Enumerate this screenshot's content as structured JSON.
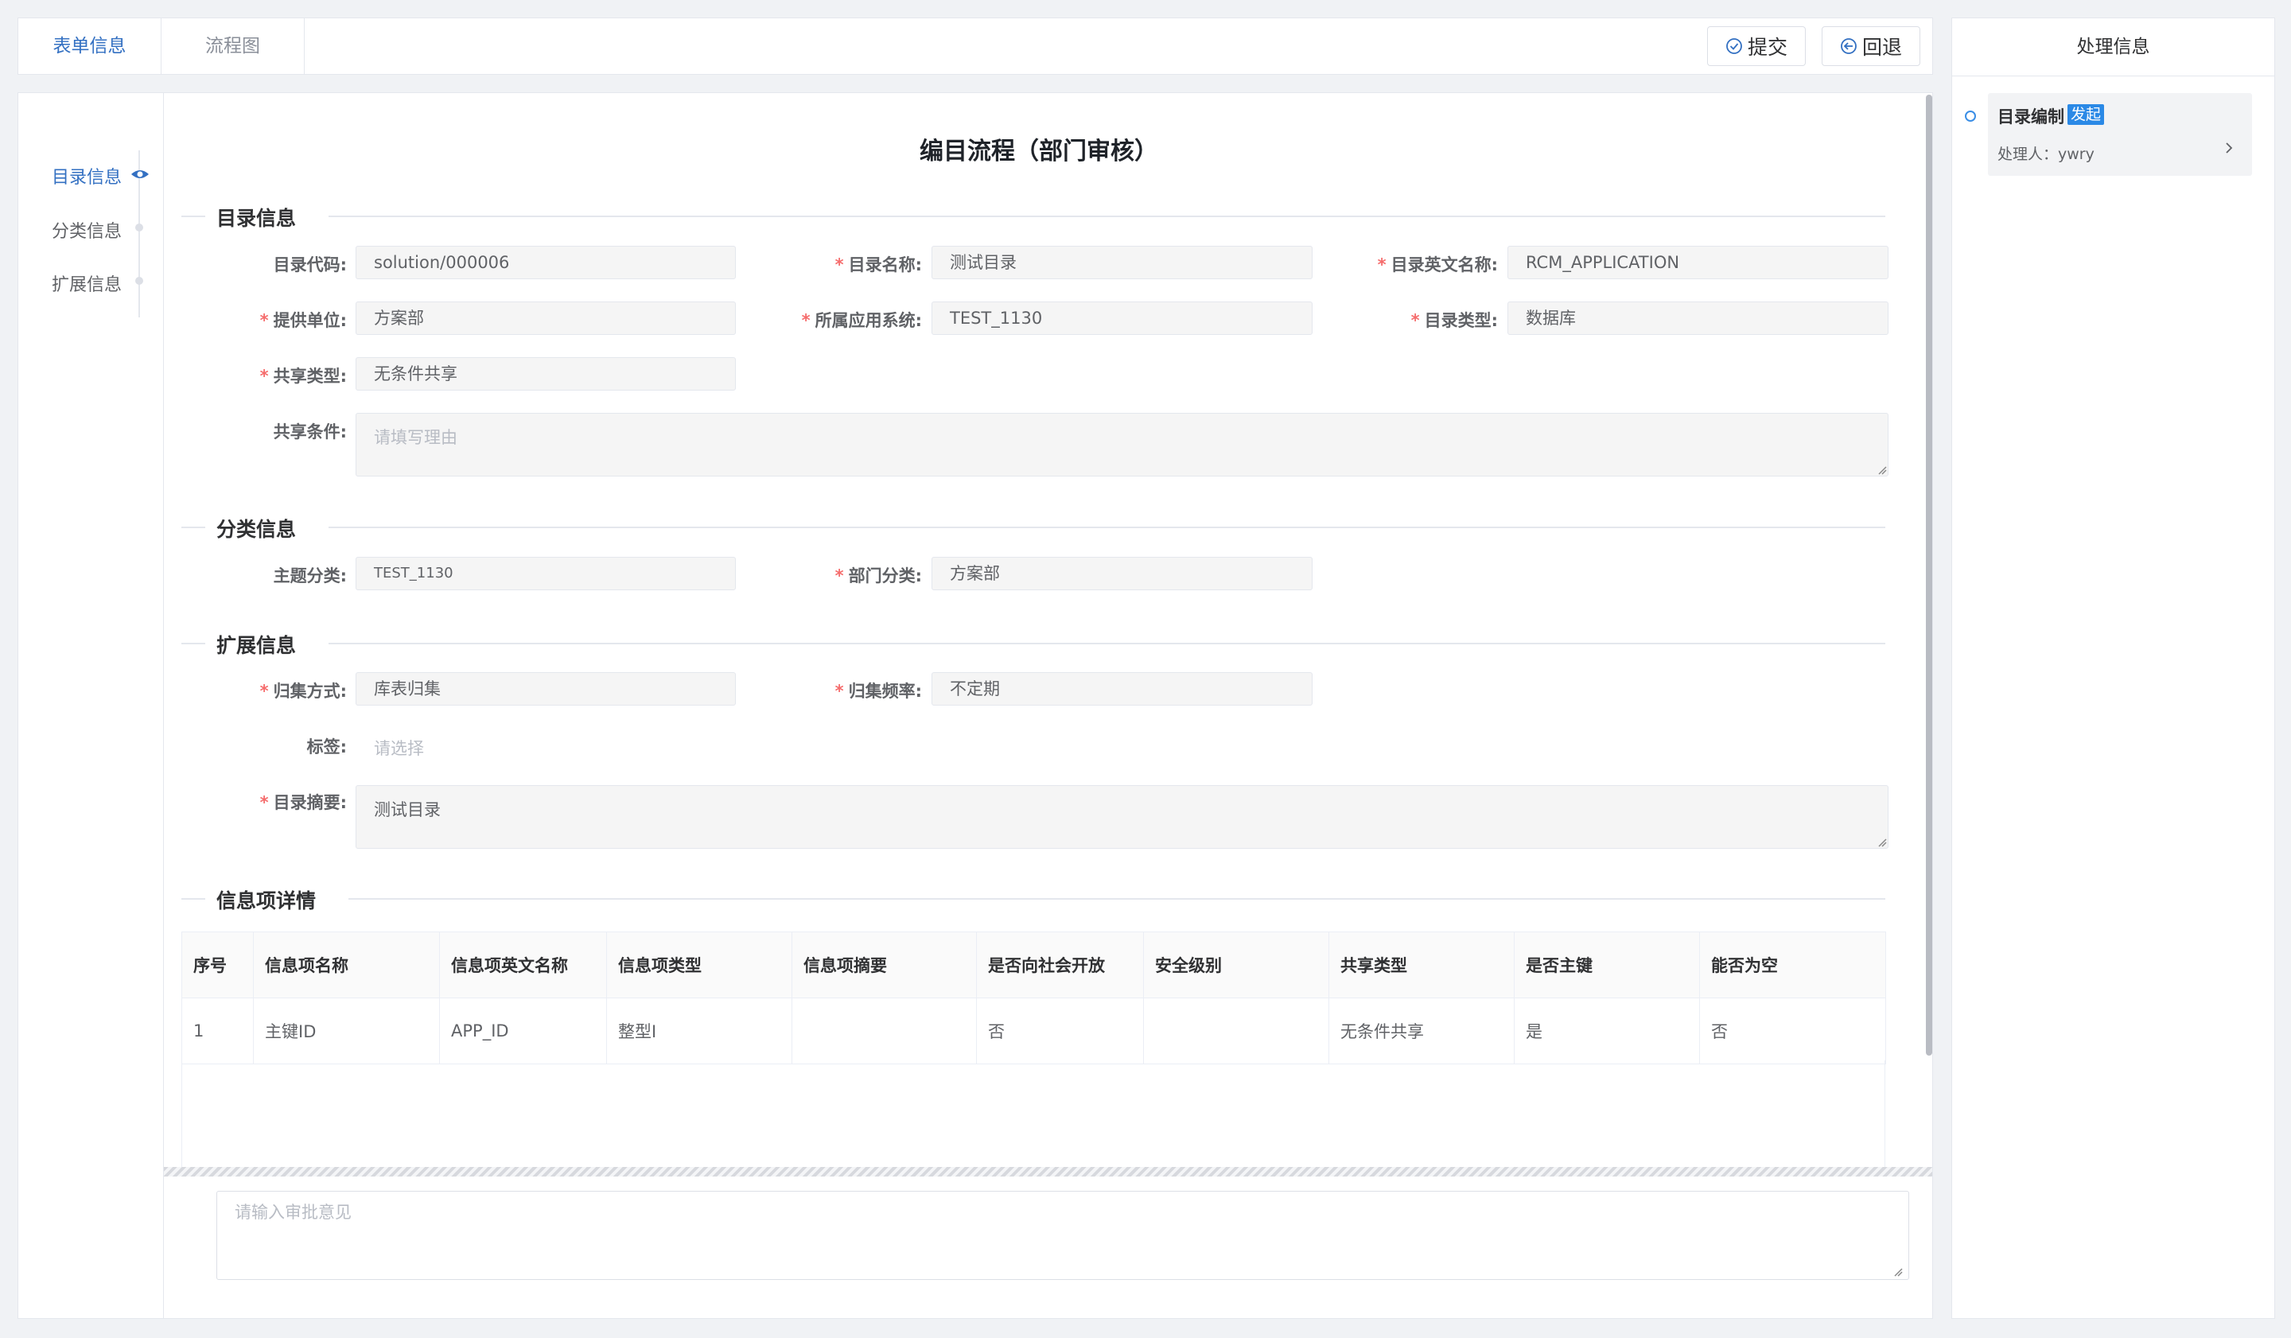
{
  "tabs": {
    "form": "表单信息",
    "flow": "流程图"
  },
  "actions": {
    "submit": "提交",
    "back": "回退"
  },
  "nav": {
    "items": [
      "目录信息",
      "分类信息",
      "扩展信息"
    ]
  },
  "form": {
    "title": "编目流程（部门审核）",
    "sections": {
      "catalog": "目录信息",
      "classify": "分类信息",
      "extend": "扩展信息",
      "items": "信息项详情"
    },
    "fields": {
      "code": {
        "label": "目录代码:",
        "value": "solution/000006"
      },
      "name": {
        "label": "目录名称:",
        "value": "测试目录"
      },
      "en_name": {
        "label": "目录英文名称:",
        "value": "RCM_APPLICATION"
      },
      "provider": {
        "label": "提供单位:",
        "value": "方案部"
      },
      "app_system": {
        "label": "所属应用系统:",
        "value": "TEST_1130"
      },
      "catalog_type": {
        "label": "目录类型:",
        "value": "数据库"
      },
      "share_type": {
        "label": "共享类型:",
        "value": "无条件共享"
      },
      "share_cond": {
        "label": "共享条件:",
        "placeholder": "请填写理由"
      },
      "topic": {
        "label": "主题分类:",
        "value": "TEST_1130"
      },
      "dept": {
        "label": "部门分类:",
        "value": "方案部"
      },
      "collect_method": {
        "label": "归集方式:",
        "value": "库表归集"
      },
      "collect_freq": {
        "label": "归集频率:",
        "value": "不定期"
      },
      "tags": {
        "label": "标签:",
        "placeholder": "请选择"
      },
      "summary": {
        "label": "目录摘要:",
        "value": "测试目录"
      }
    }
  },
  "table": {
    "headers": [
      "序号",
      "信息项名称",
      "信息项英文名称",
      "信息项类型",
      "信息项摘要",
      "是否向社会开放",
      "安全级别",
      "共享类型",
      "是否主键",
      "能否为空"
    ],
    "rows": [
      [
        "1",
        "主键ID",
        "APP_ID",
        "整型I",
        "",
        "否",
        "",
        "无条件共享",
        "是",
        "否"
      ]
    ]
  },
  "approval": {
    "placeholder": "请输入审批意见"
  },
  "process": {
    "title": "处理信息",
    "step_name": "目录编制",
    "step_badge": "发起",
    "handler": "处理人：ywry"
  },
  "colors": {
    "accent": "#3370c2",
    "required": "#f56c6c",
    "badge": "#2b89e6"
  },
  "icons": {
    "submit": "check-circle-icon",
    "back": "arrow-left-circle-icon",
    "step_more": "chevron-right-icon"
  }
}
